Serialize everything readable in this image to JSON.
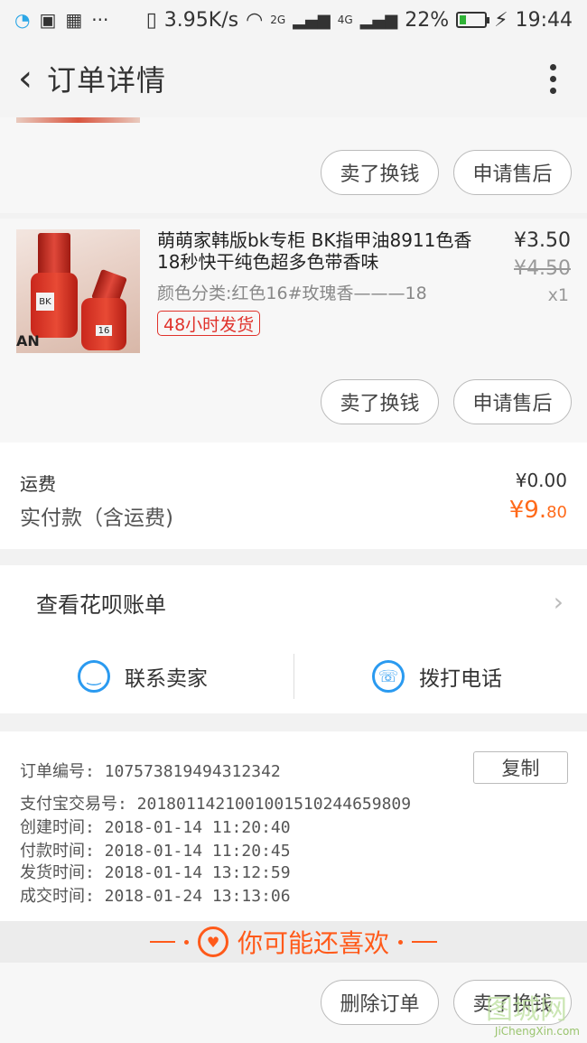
{
  "status_bar": {
    "left_icons": [
      "notification-icon",
      "image-icon",
      "app-icon",
      "more-dots"
    ],
    "left_more": "···",
    "net_speed": "3.95K/s",
    "sim1": "2G",
    "sim2": "4G",
    "battery": "22%",
    "battery_level": 0.22,
    "time": "19:44"
  },
  "navbar": {
    "title": "订单详情"
  },
  "top_buttons": {
    "sell": "卖了换钱",
    "after_sale": "申请售后"
  },
  "product": {
    "title": "萌萌家韩版bk专柜 BK指甲油8911色香18秒快干纯色超多色带香味",
    "spec": "颜色分类:红色16#玫瑰香———18",
    "tag": "48小时发货",
    "price": "¥3.50",
    "orig_price": "¥4.50",
    "qty": "x1",
    "img_label1": "BK",
    "img_label2": "16",
    "img_brand": "AN"
  },
  "product_buttons": {
    "sell": "卖了换钱",
    "after_sale": "申请售后"
  },
  "fees": {
    "shipping_label": "运费",
    "shipping_value": "¥0.00",
    "paid_label": "实付款（含运费)",
    "paid_currency": "¥9.",
    "paid_cents": "80"
  },
  "huabei": {
    "label": "查看花呗账单",
    "chevron": "›"
  },
  "contact": {
    "seller": "联系卖家",
    "phone": "拨打电话"
  },
  "order_info": {
    "order_no": "订单编号:  1075738194943123​42",
    "copy": "复制",
    "alipay_no": "支付宝交易号:  2018011421001001510244659809",
    "created": "创建时间:  2018-01-14 11:20:40",
    "paid": "付款时间:  2018-01-14 11:20:45",
    "shipped": "发货时间:  2018-01-14 13:12:59",
    "completed": "成交时间:  2018-01-24 13:13:06"
  },
  "recommend": {
    "label": "你可能还喜欢"
  },
  "bottom_buttons": {
    "delete": "删除订单",
    "sell": "卖了换钱"
  },
  "watermark": {
    "main": "图城网",
    "url": "JiChengXin.com"
  },
  "colors": {
    "accent": "#ff5a1a",
    "price_orange": "#ff6a1a",
    "blue": "#2a9af0",
    "tag_red": "#e0322b"
  }
}
